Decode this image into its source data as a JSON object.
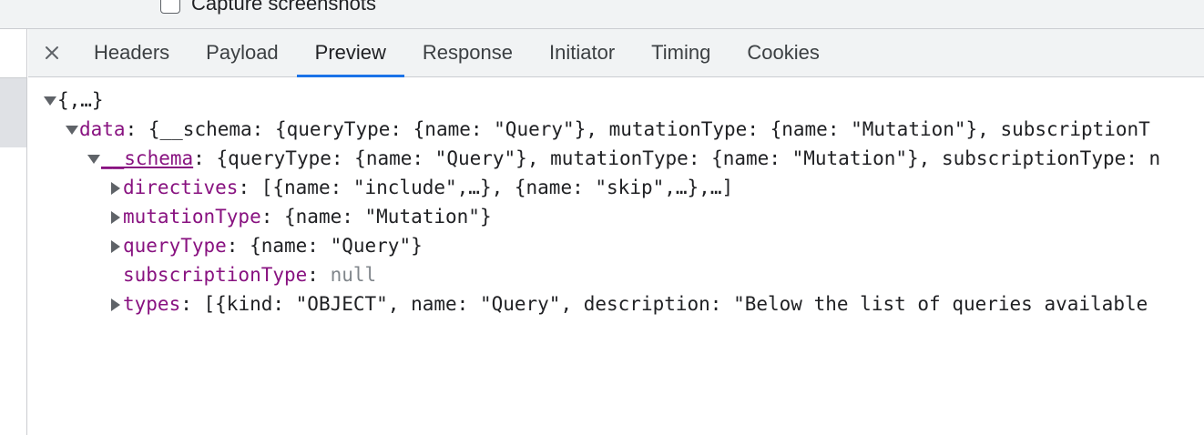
{
  "top": {
    "checkbox_label": "Capture screenshots"
  },
  "tabs": [
    {
      "label": "Headers"
    },
    {
      "label": "Payload"
    },
    {
      "label": "Preview"
    },
    {
      "label": "Response"
    },
    {
      "label": "Initiator"
    },
    {
      "label": "Timing"
    },
    {
      "label": "Cookies"
    }
  ],
  "close_glyph": "×",
  "active_tab": "Preview",
  "tree": {
    "root": {
      "summary": "{,…}"
    },
    "data": {
      "key": "data",
      "value": "{__schema: {queryType: {name: \"Query\"}, mutationType: {name: \"Mutation\"}, subscriptionT"
    },
    "schema": {
      "key": "__schema",
      "value": "{queryType: {name: \"Query\"}, mutationType: {name: \"Mutation\"}, subscriptionType: n"
    },
    "directives": {
      "key": "directives",
      "value": "[{name: \"include\",…}, {name: \"skip\",…},…]"
    },
    "mutationType": {
      "key": "mutationType",
      "value": "{name: \"Mutation\"}"
    },
    "queryType": {
      "key": "queryType",
      "value": "{name: \"Query\"}"
    },
    "subscriptionType": {
      "key": "subscriptionType",
      "value": "null"
    },
    "types": {
      "key": "types",
      "value": "[{kind: \"OBJECT\", name: \"Query\", description: \"Below the list of queries available"
    }
  },
  "colors": {
    "key": "#881280",
    "null": "#80868b",
    "accent": "#1a73e8",
    "panel_bg": "#f1f3f4"
  }
}
